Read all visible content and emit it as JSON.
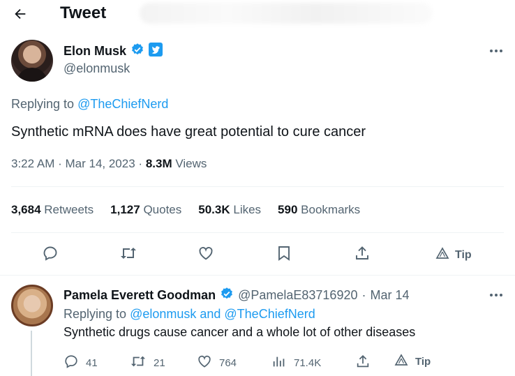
{
  "header": {
    "title": "Tweet"
  },
  "tweet": {
    "author_name": "Elon Musk",
    "author_handle": "@elonmusk",
    "replying_prefix": "Replying to ",
    "replying_to": "@TheChiefNerd",
    "text": "Synthetic mRNA does have great potential to cure cancer",
    "time": "3:22 AM",
    "date": "Mar 14, 2023",
    "views_count": "8.3M",
    "views_label": "Views",
    "stats": {
      "retweets_count": "3,684",
      "retweets_label": "Retweets",
      "quotes_count": "1,127",
      "quotes_label": "Quotes",
      "likes_count": "50.3K",
      "likes_label": "Likes",
      "bookmarks_count": "590",
      "bookmarks_label": "Bookmarks"
    },
    "tip_label": "Tip"
  },
  "reply": {
    "author_name": "Pamela Everett Goodman",
    "author_handle": "@PamelaE83716920",
    "date": "Mar 14",
    "replying_prefix": "Replying to ",
    "replying_to": "@elonmusk and @TheChiefNerd",
    "text": "Synthetic drugs cause cancer and a whole lot of other diseases",
    "replies": "41",
    "retweets": "21",
    "likes": "764",
    "views": "71.4K",
    "tip_label": "Tip"
  },
  "colors": {
    "accent": "#1d9bf0",
    "text": "#0f1419",
    "muted": "#536471",
    "verified": "#1d9bf0"
  }
}
